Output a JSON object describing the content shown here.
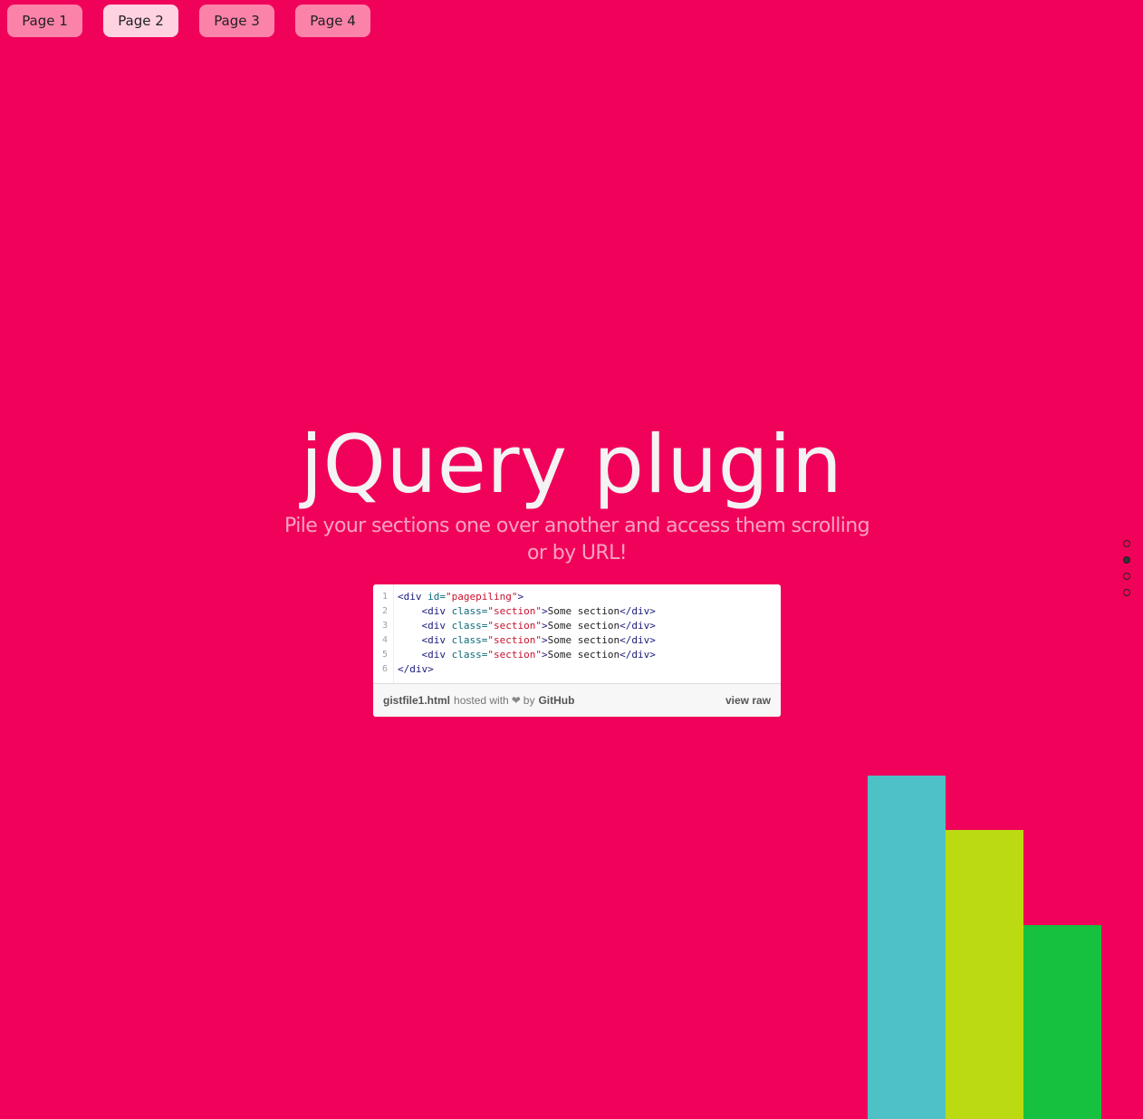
{
  "menu": {
    "items": [
      {
        "label": "Page 1",
        "active": false
      },
      {
        "label": "Page 2",
        "active": true
      },
      {
        "label": "Page 3",
        "active": false
      },
      {
        "label": "Page 4",
        "active": false
      }
    ]
  },
  "hero": {
    "title": "jQuery plugin",
    "subtitle": "Pile your sections one over another and access them scrolling or by URL!"
  },
  "gist": {
    "lines": [
      {
        "num": "1",
        "parts": [
          [
            "tag",
            "<div "
          ],
          [
            "attr",
            "id="
          ],
          [
            "str",
            "\"pagepiling\""
          ],
          [
            "tag",
            ">"
          ]
        ]
      },
      {
        "num": "2",
        "parts": [
          [
            "txt",
            "    "
          ],
          [
            "tag",
            "<div "
          ],
          [
            "attr",
            "class="
          ],
          [
            "str",
            "\"section\""
          ],
          [
            "tag",
            ">"
          ],
          [
            "txt",
            "Some section"
          ],
          [
            "tag",
            "</div>"
          ]
        ]
      },
      {
        "num": "3",
        "parts": [
          [
            "txt",
            "    "
          ],
          [
            "tag",
            "<div "
          ],
          [
            "attr",
            "class="
          ],
          [
            "str",
            "\"section\""
          ],
          [
            "tag",
            ">"
          ],
          [
            "txt",
            "Some section"
          ],
          [
            "tag",
            "</div>"
          ]
        ]
      },
      {
        "num": "4",
        "parts": [
          [
            "txt",
            "    "
          ],
          [
            "tag",
            "<div "
          ],
          [
            "attr",
            "class="
          ],
          [
            "str",
            "\"section\""
          ],
          [
            "tag",
            ">"
          ],
          [
            "txt",
            "Some section"
          ],
          [
            "tag",
            "</div>"
          ]
        ]
      },
      {
        "num": "5",
        "parts": [
          [
            "txt",
            "    "
          ],
          [
            "tag",
            "<div "
          ],
          [
            "attr",
            "class="
          ],
          [
            "str",
            "\"section\""
          ],
          [
            "tag",
            ">"
          ],
          [
            "txt",
            "Some section"
          ],
          [
            "tag",
            "</div>"
          ]
        ]
      },
      {
        "num": "6",
        "parts": [
          [
            "tag",
            "</div>"
          ]
        ]
      }
    ],
    "meta": {
      "filename": "gistfile1.html",
      "hosted_with": "hosted with",
      "heart_icon": "heart-icon",
      "by": "by",
      "github": "GitHub",
      "view_raw": "view raw"
    }
  },
  "nav_dots": {
    "count": 4,
    "active_index": 1
  },
  "colors": {
    "background": "#f0025a",
    "bar_teal": "#4dc1c6",
    "bar_lime": "#bcda12",
    "bar_green": "#15c13f"
  }
}
